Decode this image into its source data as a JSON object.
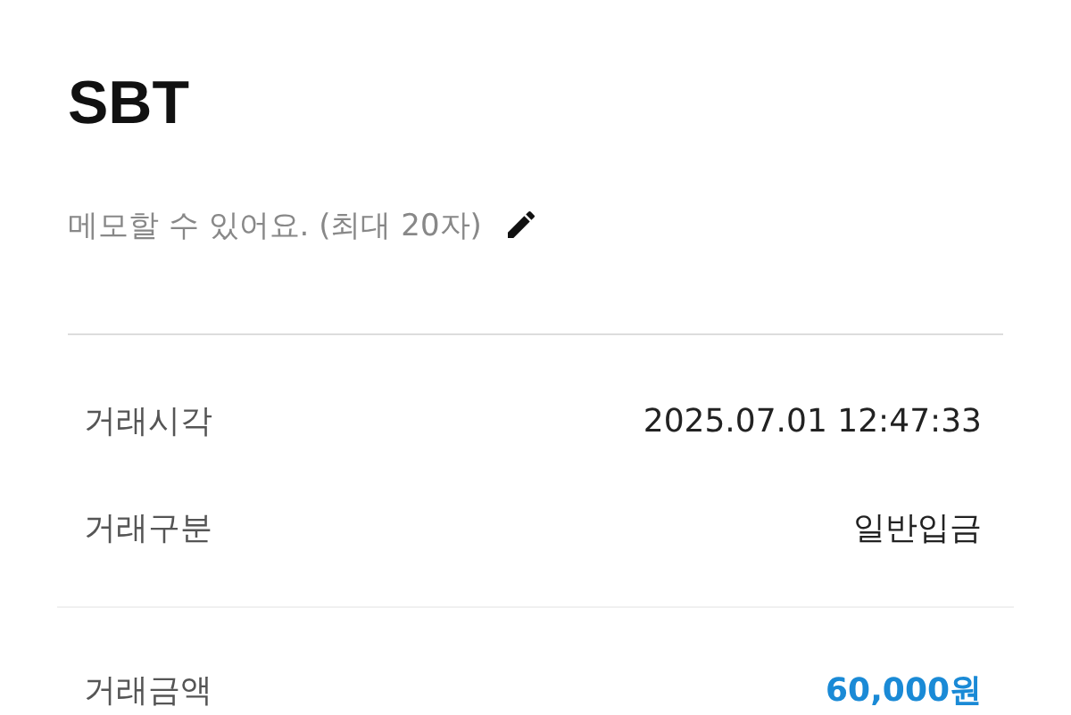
{
  "title": "SBT",
  "memo": {
    "placeholder": "메모할 수 있어요. (최대 20자)"
  },
  "details": [
    {
      "label": "거래시각",
      "value": "2025.07.01 12:47:33",
      "highlight": false
    },
    {
      "label": "거래구분",
      "value": "일반입금",
      "highlight": false
    }
  ],
  "amount": {
    "label": "거래금액",
    "value": "60,000원",
    "highlight": true
  }
}
